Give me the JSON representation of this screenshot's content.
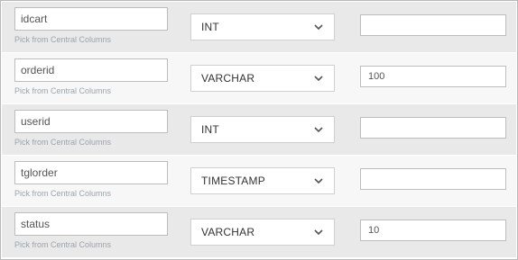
{
  "pick_link_label": "Pick from Central Columns",
  "columns": [
    {
      "name": "idcart",
      "type": "INT",
      "length": ""
    },
    {
      "name": "orderid",
      "type": "VARCHAR",
      "length": "100"
    },
    {
      "name": "userid",
      "type": "INT",
      "length": ""
    },
    {
      "name": "tglorder",
      "type": "TIMESTAMP",
      "length": ""
    },
    {
      "name": "status",
      "type": "VARCHAR",
      "length": "10"
    }
  ],
  "icons": {
    "dropdown": "chevron-down-icon"
  },
  "colors": {
    "row_odd": "#e9e9e9",
    "row_even": "#f7f7f7",
    "link": "#9aa4ad"
  }
}
